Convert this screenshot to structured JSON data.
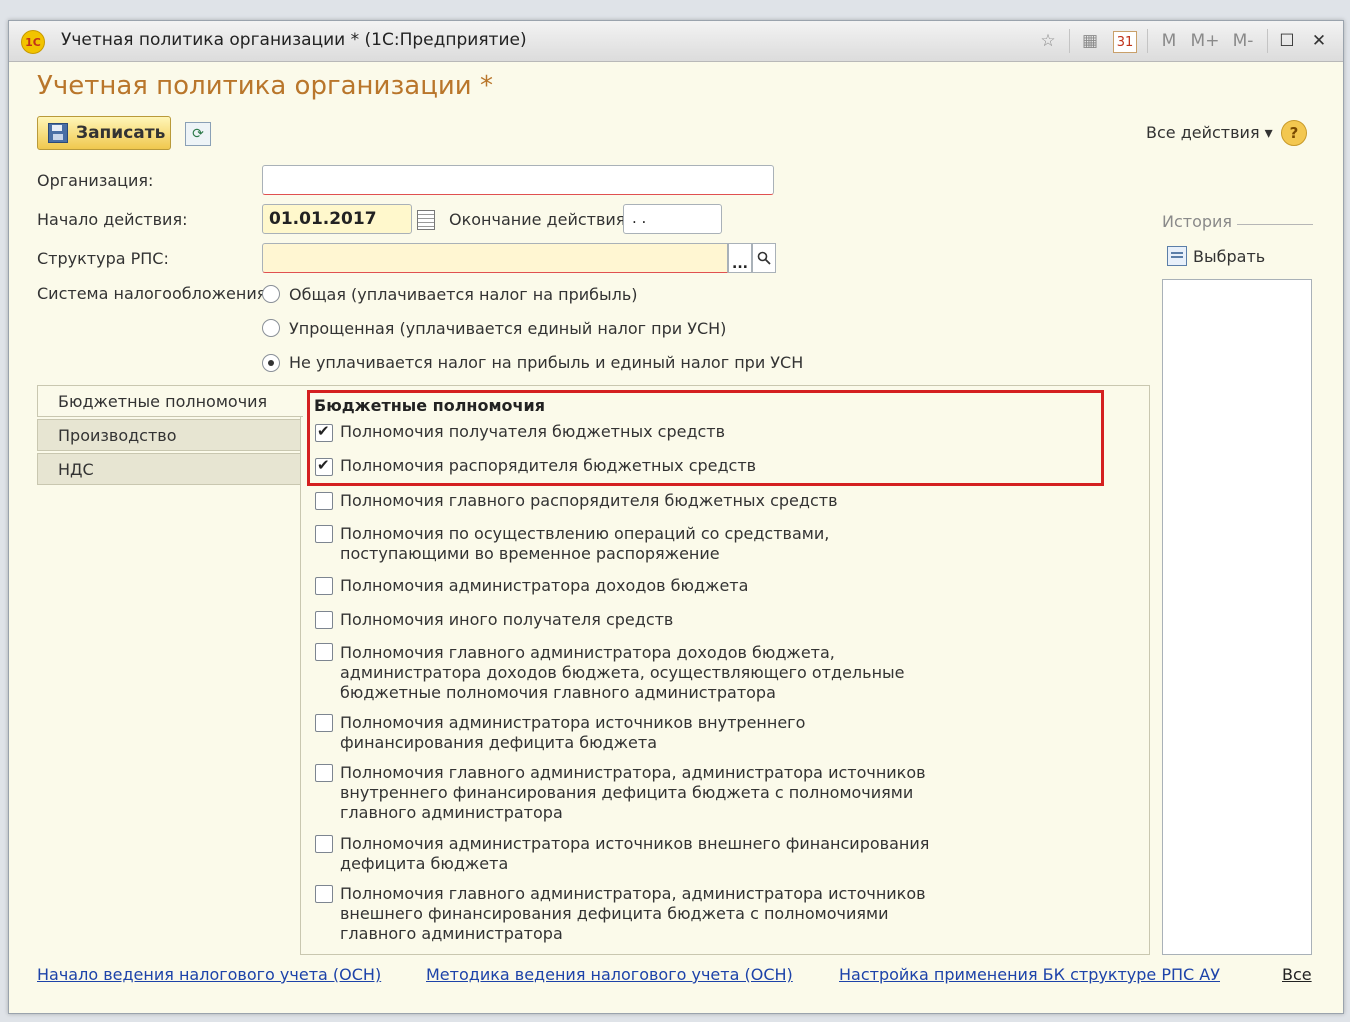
{
  "window": {
    "title": "Учетная политика организации * (1С:Предприятие)",
    "logo": "1С",
    "toolbar_icons": [
      "star-icon",
      "calculator-icon",
      "calendar-icon"
    ],
    "memory_buttons": [
      "M",
      "M+",
      "M-"
    ]
  },
  "form": {
    "title": "Учетная политика организации *",
    "save_label": "Записать",
    "all_actions_label": "Все действия ▾",
    "help_label": "?"
  },
  "fields": {
    "organization_label": "Организация:",
    "organization_value": "",
    "start_label": "Начало действия:",
    "start_value": "01.01.2017",
    "end_label": "Окончание действия:",
    "end_value": " . .",
    "rps_label": "Структура РПС:",
    "rps_value": "",
    "rps_pick": "...",
    "tax_label": "Система налогообложения:"
  },
  "tax_options": [
    {
      "label": "Общая (уплачивается налог на прибыль)",
      "selected": false
    },
    {
      "label": "Упрощенная (уплачивается единый налог при УСН)",
      "selected": false
    },
    {
      "label": "Не уплачивается налог на прибыль и единый налог при УСН",
      "selected": true
    }
  ],
  "tabs": [
    {
      "label": "Бюджетные полномочия",
      "active": true
    },
    {
      "label": "Производство",
      "active": false
    },
    {
      "label": "НДС",
      "active": false
    }
  ],
  "panel": {
    "group_title": "Бюджетные полномочия",
    "checkboxes": [
      {
        "label": "Полномочия получателя бюджетных средств",
        "checked": true
      },
      {
        "label": "Полномочия распорядителя бюджетных средств",
        "checked": true
      },
      {
        "label": "Полномочия главного распорядителя бюджетных средств",
        "checked": false
      },
      {
        "label": "Полномочия по осуществлению операций со средствами, поступающими во временное распоряжение",
        "checked": false
      },
      {
        "label": "Полномочия администратора доходов бюджета",
        "checked": false
      },
      {
        "label": "Полномочия иного получателя средств",
        "checked": false
      },
      {
        "label": "Полномочия главного администратора доходов бюджета, администратора доходов бюджета, осуществляющего отдельные бюджетные полномочия главного администратора",
        "checked": false
      },
      {
        "label": "Полномочия администратора источников внутреннего финансирования дефицита бюджета",
        "checked": false
      },
      {
        "label": "Полномочия главного администратора, администратора источников внутреннего финансирования дефицита бюджета с полномочиями главного администратора",
        "checked": false
      },
      {
        "label": "Полномочия администратора источников внешнего финансирования дефицита бюджета",
        "checked": false
      },
      {
        "label": "Полномочия главного администратора, администратора источников внешнего финансирования дефицита бюджета с полномочиями главного администратора",
        "checked": false
      }
    ]
  },
  "history": {
    "label": "История",
    "choose_label": "Выбрать"
  },
  "links": {
    "link1": "Начало ведения налогового учета (ОСН)",
    "link2": "Методика ведения налогового учета (ОСН)",
    "link3": "Настройка применения БК структуре РПС АУ",
    "link4": "Все"
  },
  "colors": {
    "title_orange": "#b9762b",
    "highlight_red": "#d42020",
    "link_blue": "#1d43a9",
    "form_bg": "#fbfaea"
  }
}
